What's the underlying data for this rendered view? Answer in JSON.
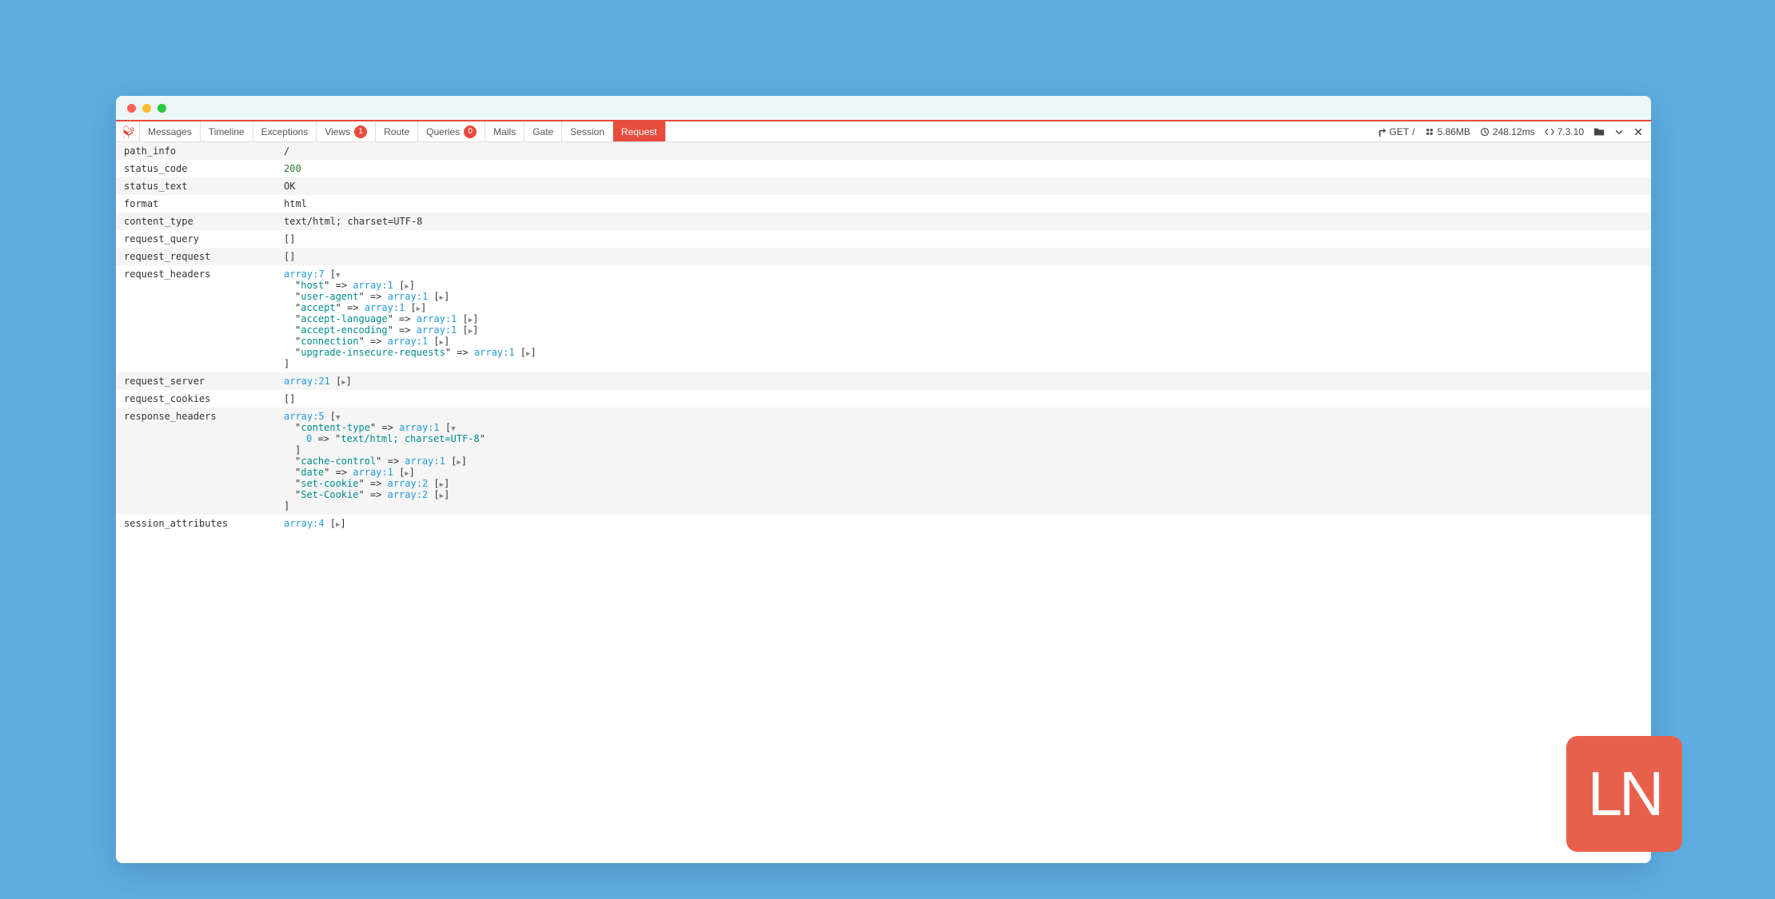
{
  "tabs": [
    {
      "label": "Messages",
      "badge": null
    },
    {
      "label": "Timeline",
      "badge": null
    },
    {
      "label": "Exceptions",
      "badge": null
    },
    {
      "label": "Views",
      "badge": "1"
    },
    {
      "label": "Route",
      "badge": null
    },
    {
      "label": "Queries",
      "badge": "0"
    },
    {
      "label": "Mails",
      "badge": null
    },
    {
      "label": "Gate",
      "badge": null
    },
    {
      "label": "Session",
      "badge": null
    },
    {
      "label": "Request",
      "badge": null,
      "active": true
    }
  ],
  "stats": {
    "method": "GET",
    "path": "/",
    "memory": "5.86MB",
    "time": "248.12ms",
    "php": "7.3.10"
  },
  "rows": {
    "path_info": "/",
    "status_code": "200",
    "status_text": "OK",
    "format": "html",
    "content_type": "text/html; charset=UTF-8",
    "request_query": "[]",
    "request_request": "[]",
    "request_headers_label": "request_headers",
    "request_server_label": "request_server",
    "request_cookies_label": "request_cookies",
    "request_cookies": "[]",
    "response_headers_label": "response_headers",
    "session_attributes_label": "session_attributes"
  },
  "request_headers": {
    "prefix": "array:7",
    "items": [
      {
        "key": "host",
        "val": "array:1"
      },
      {
        "key": "user-agent",
        "val": "array:1"
      },
      {
        "key": "accept",
        "val": "array:1"
      },
      {
        "key": "accept-language",
        "val": "array:1"
      },
      {
        "key": "accept-encoding",
        "val": "array:1"
      },
      {
        "key": "connection",
        "val": "array:1"
      },
      {
        "key": "upgrade-insecure-requests",
        "val": "array:1"
      }
    ]
  },
  "request_server": "array:21",
  "response_headers": {
    "prefix": "array:5",
    "content_type": {
      "key": "content-type",
      "val": "array:1",
      "inner_idx": "0",
      "inner_val": "text/html; charset=UTF-8"
    },
    "items": [
      {
        "key": "cache-control",
        "val": "array:1"
      },
      {
        "key": "date",
        "val": "array:1"
      },
      {
        "key": "set-cookie",
        "val": "array:2"
      },
      {
        "key": "Set-Cookie",
        "val": "array:2"
      }
    ]
  },
  "session_attributes": "array:4",
  "ln": "LN"
}
